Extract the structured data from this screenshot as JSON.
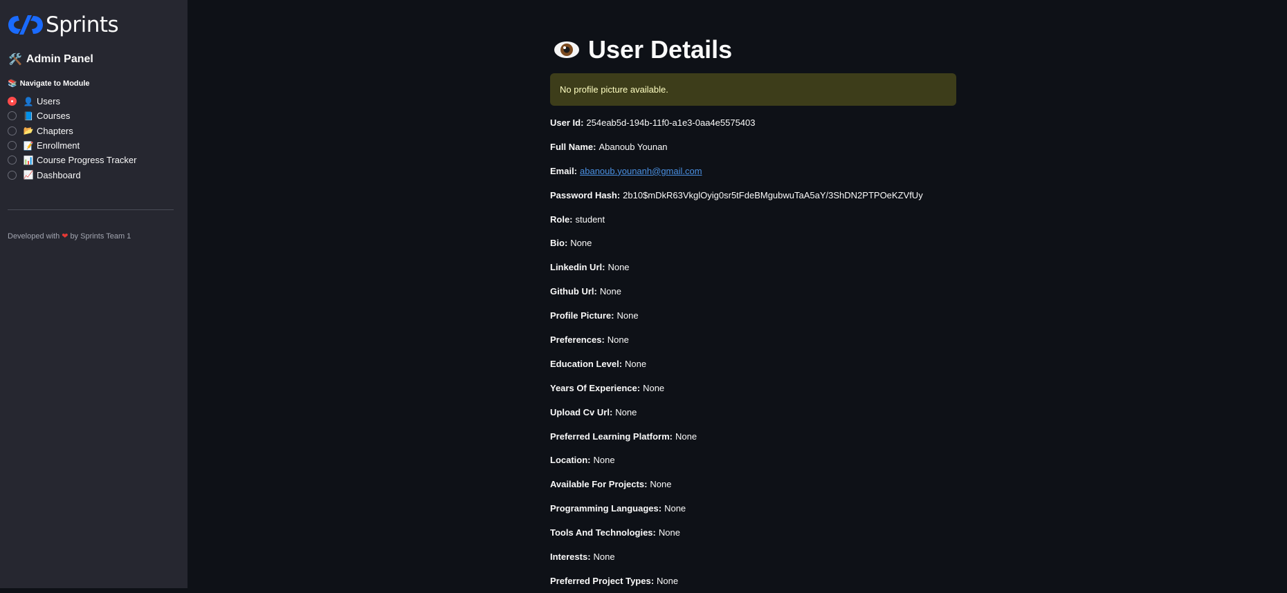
{
  "sidebar": {
    "logo_text": "Sprints",
    "admin_title": "Admin Panel",
    "admin_icon": "🛠️",
    "nav_label": "Navigate to Module",
    "nav_icon": "📚",
    "items": [
      {
        "label": "Users",
        "icon": "👤",
        "selected": true
      },
      {
        "label": "Courses",
        "icon": "📘",
        "selected": false
      },
      {
        "label": "Chapters",
        "icon": "📂",
        "selected": false
      },
      {
        "label": "Enrollment",
        "icon": "📝",
        "selected": false
      },
      {
        "label": "Course Progress Tracker",
        "icon": "📊",
        "selected": false
      },
      {
        "label": "Dashboard",
        "icon": "📈",
        "selected": false
      }
    ],
    "footer_prefix": "Developed with",
    "footer_heart": "❤",
    "footer_suffix": "by Sprints Team 1"
  },
  "main": {
    "title": "User Details",
    "alert": "No profile picture available.",
    "fields": [
      {
        "label": "User Id:",
        "value": "254eab5d-194b-11f0-a1e3-0aa4e5575403"
      },
      {
        "label": "Full Name:",
        "value": "Abanoub Younan"
      },
      {
        "label": "Email:",
        "value": "abanoub.younanh@gmail.com",
        "link": true
      },
      {
        "label": "Password Hash:",
        "value": "2b10$mDkR63VkglOyig0sr5tFdeBMgubwuTaA5aY/3ShDN2PTPOeKZVfUy"
      },
      {
        "label": "Role:",
        "value": "student"
      },
      {
        "label": "Bio:",
        "value": "None"
      },
      {
        "label": "Linkedin Url:",
        "value": "None"
      },
      {
        "label": "Github Url:",
        "value": "None"
      },
      {
        "label": "Profile Picture:",
        "value": "None"
      },
      {
        "label": "Preferences:",
        "value": "None"
      },
      {
        "label": "Education Level:",
        "value": "None"
      },
      {
        "label": "Years Of Experience:",
        "value": "None"
      },
      {
        "label": "Upload Cv Url:",
        "value": "None"
      },
      {
        "label": "Preferred Learning Platform:",
        "value": "None"
      },
      {
        "label": "Location:",
        "value": "None"
      },
      {
        "label": "Available For Projects:",
        "value": "None"
      },
      {
        "label": "Programming Languages:",
        "value": "None"
      },
      {
        "label": "Tools And Technologies:",
        "value": "None"
      },
      {
        "label": "Interests:",
        "value": "None"
      },
      {
        "label": "Preferred Project Types:",
        "value": "None"
      }
    ]
  },
  "colors": {
    "sidebar_bg": "#262730",
    "main_bg": "#0e1117",
    "radio_selected": "#ff4b4b",
    "alert_bg": "#3d3d1a",
    "alert_text": "#ffffc2",
    "link": "#4a90e2",
    "logo_blue": "#1a6bff"
  }
}
